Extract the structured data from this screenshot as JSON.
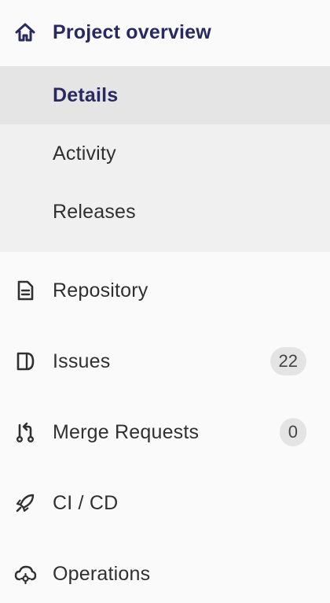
{
  "sidebar": {
    "header": {
      "label": "Project overview",
      "icon": "home-icon"
    },
    "subitems": [
      {
        "label": "Details",
        "active": true
      },
      {
        "label": "Activity",
        "active": false
      },
      {
        "label": "Releases",
        "active": false
      }
    ],
    "items": [
      {
        "label": "Repository",
        "icon": "document-icon"
      },
      {
        "label": "Issues",
        "icon": "issues-icon",
        "badge": "22"
      },
      {
        "label": "Merge Requests",
        "icon": "merge-request-icon",
        "badge": "0"
      },
      {
        "label": "CI / CD",
        "icon": "rocket-icon"
      },
      {
        "label": "Operations",
        "icon": "cloud-gear-icon"
      }
    ]
  },
  "colors": {
    "accent": "#292961",
    "text": "#303030",
    "background": "#fafafa",
    "subgroup_background": "#f0f0f0",
    "active_background": "#e5e5e5",
    "badge_background": "#e4e4e4"
  }
}
